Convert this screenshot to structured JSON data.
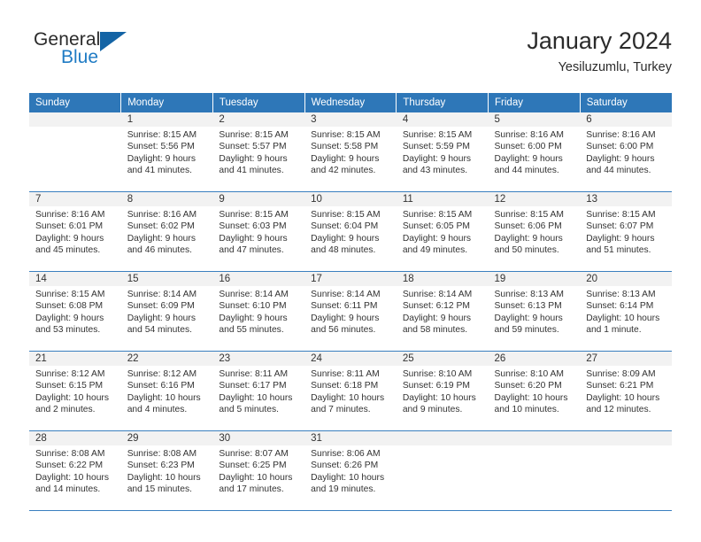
{
  "brand": {
    "name_part1": "General",
    "name_part2": "Blue",
    "logo_icon": "triangle-logo-icon",
    "accent_color": "#1f7bc4"
  },
  "header": {
    "title": "January 2024",
    "subtitle": "Yesiluzumlu, Turkey"
  },
  "calendar": {
    "header_bg": "#2e77b8",
    "daynum_bg": "#f2f2f2",
    "row_divider": "#3a7fbf",
    "weekday_headers": [
      "Sunday",
      "Monday",
      "Tuesday",
      "Wednesday",
      "Thursday",
      "Friday",
      "Saturday"
    ],
    "weeks": [
      [
        {
          "day": "",
          "sunrise": "",
          "sunset": "",
          "daylight_line1": "",
          "daylight_line2": "",
          "empty": true
        },
        {
          "day": "1",
          "sunrise": "Sunrise: 8:15 AM",
          "sunset": "Sunset: 5:56 PM",
          "daylight_line1": "Daylight: 9 hours",
          "daylight_line2": "and 41 minutes."
        },
        {
          "day": "2",
          "sunrise": "Sunrise: 8:15 AM",
          "sunset": "Sunset: 5:57 PM",
          "daylight_line1": "Daylight: 9 hours",
          "daylight_line2": "and 41 minutes."
        },
        {
          "day": "3",
          "sunrise": "Sunrise: 8:15 AM",
          "sunset": "Sunset: 5:58 PM",
          "daylight_line1": "Daylight: 9 hours",
          "daylight_line2": "and 42 minutes."
        },
        {
          "day": "4",
          "sunrise": "Sunrise: 8:15 AM",
          "sunset": "Sunset: 5:59 PM",
          "daylight_line1": "Daylight: 9 hours",
          "daylight_line2": "and 43 minutes."
        },
        {
          "day": "5",
          "sunrise": "Sunrise: 8:16 AM",
          "sunset": "Sunset: 6:00 PM",
          "daylight_line1": "Daylight: 9 hours",
          "daylight_line2": "and 44 minutes."
        },
        {
          "day": "6",
          "sunrise": "Sunrise: 8:16 AM",
          "sunset": "Sunset: 6:00 PM",
          "daylight_line1": "Daylight: 9 hours",
          "daylight_line2": "and 44 minutes."
        }
      ],
      [
        {
          "day": "7",
          "sunrise": "Sunrise: 8:16 AM",
          "sunset": "Sunset: 6:01 PM",
          "daylight_line1": "Daylight: 9 hours",
          "daylight_line2": "and 45 minutes."
        },
        {
          "day": "8",
          "sunrise": "Sunrise: 8:16 AM",
          "sunset": "Sunset: 6:02 PM",
          "daylight_line1": "Daylight: 9 hours",
          "daylight_line2": "and 46 minutes."
        },
        {
          "day": "9",
          "sunrise": "Sunrise: 8:15 AM",
          "sunset": "Sunset: 6:03 PM",
          "daylight_line1": "Daylight: 9 hours",
          "daylight_line2": "and 47 minutes."
        },
        {
          "day": "10",
          "sunrise": "Sunrise: 8:15 AM",
          "sunset": "Sunset: 6:04 PM",
          "daylight_line1": "Daylight: 9 hours",
          "daylight_line2": "and 48 minutes."
        },
        {
          "day": "11",
          "sunrise": "Sunrise: 8:15 AM",
          "sunset": "Sunset: 6:05 PM",
          "daylight_line1": "Daylight: 9 hours",
          "daylight_line2": "and 49 minutes."
        },
        {
          "day": "12",
          "sunrise": "Sunrise: 8:15 AM",
          "sunset": "Sunset: 6:06 PM",
          "daylight_line1": "Daylight: 9 hours",
          "daylight_line2": "and 50 minutes."
        },
        {
          "day": "13",
          "sunrise": "Sunrise: 8:15 AM",
          "sunset": "Sunset: 6:07 PM",
          "daylight_line1": "Daylight: 9 hours",
          "daylight_line2": "and 51 minutes."
        }
      ],
      [
        {
          "day": "14",
          "sunrise": "Sunrise: 8:15 AM",
          "sunset": "Sunset: 6:08 PM",
          "daylight_line1": "Daylight: 9 hours",
          "daylight_line2": "and 53 minutes."
        },
        {
          "day": "15",
          "sunrise": "Sunrise: 8:14 AM",
          "sunset": "Sunset: 6:09 PM",
          "daylight_line1": "Daylight: 9 hours",
          "daylight_line2": "and 54 minutes."
        },
        {
          "day": "16",
          "sunrise": "Sunrise: 8:14 AM",
          "sunset": "Sunset: 6:10 PM",
          "daylight_line1": "Daylight: 9 hours",
          "daylight_line2": "and 55 minutes."
        },
        {
          "day": "17",
          "sunrise": "Sunrise: 8:14 AM",
          "sunset": "Sunset: 6:11 PM",
          "daylight_line1": "Daylight: 9 hours",
          "daylight_line2": "and 56 minutes."
        },
        {
          "day": "18",
          "sunrise": "Sunrise: 8:14 AM",
          "sunset": "Sunset: 6:12 PM",
          "daylight_line1": "Daylight: 9 hours",
          "daylight_line2": "and 58 minutes."
        },
        {
          "day": "19",
          "sunrise": "Sunrise: 8:13 AM",
          "sunset": "Sunset: 6:13 PM",
          "daylight_line1": "Daylight: 9 hours",
          "daylight_line2": "and 59 minutes."
        },
        {
          "day": "20",
          "sunrise": "Sunrise: 8:13 AM",
          "sunset": "Sunset: 6:14 PM",
          "daylight_line1": "Daylight: 10 hours",
          "daylight_line2": "and 1 minute."
        }
      ],
      [
        {
          "day": "21",
          "sunrise": "Sunrise: 8:12 AM",
          "sunset": "Sunset: 6:15 PM",
          "daylight_line1": "Daylight: 10 hours",
          "daylight_line2": "and 2 minutes."
        },
        {
          "day": "22",
          "sunrise": "Sunrise: 8:12 AM",
          "sunset": "Sunset: 6:16 PM",
          "daylight_line1": "Daylight: 10 hours",
          "daylight_line2": "and 4 minutes."
        },
        {
          "day": "23",
          "sunrise": "Sunrise: 8:11 AM",
          "sunset": "Sunset: 6:17 PM",
          "daylight_line1": "Daylight: 10 hours",
          "daylight_line2": "and 5 minutes."
        },
        {
          "day": "24",
          "sunrise": "Sunrise: 8:11 AM",
          "sunset": "Sunset: 6:18 PM",
          "daylight_line1": "Daylight: 10 hours",
          "daylight_line2": "and 7 minutes."
        },
        {
          "day": "25",
          "sunrise": "Sunrise: 8:10 AM",
          "sunset": "Sunset: 6:19 PM",
          "daylight_line1": "Daylight: 10 hours",
          "daylight_line2": "and 9 minutes."
        },
        {
          "day": "26",
          "sunrise": "Sunrise: 8:10 AM",
          "sunset": "Sunset: 6:20 PM",
          "daylight_line1": "Daylight: 10 hours",
          "daylight_line2": "and 10 minutes."
        },
        {
          "day": "27",
          "sunrise": "Sunrise: 8:09 AM",
          "sunset": "Sunset: 6:21 PM",
          "daylight_line1": "Daylight: 10 hours",
          "daylight_line2": "and 12 minutes."
        }
      ],
      [
        {
          "day": "28",
          "sunrise": "Sunrise: 8:08 AM",
          "sunset": "Sunset: 6:22 PM",
          "daylight_line1": "Daylight: 10 hours",
          "daylight_line2": "and 14 minutes."
        },
        {
          "day": "29",
          "sunrise": "Sunrise: 8:08 AM",
          "sunset": "Sunset: 6:23 PM",
          "daylight_line1": "Daylight: 10 hours",
          "daylight_line2": "and 15 minutes."
        },
        {
          "day": "30",
          "sunrise": "Sunrise: 8:07 AM",
          "sunset": "Sunset: 6:25 PM",
          "daylight_line1": "Daylight: 10 hours",
          "daylight_line2": "and 17 minutes."
        },
        {
          "day": "31",
          "sunrise": "Sunrise: 8:06 AM",
          "sunset": "Sunset: 6:26 PM",
          "daylight_line1": "Daylight: 10 hours",
          "daylight_line2": "and 19 minutes."
        },
        {
          "day": "",
          "sunrise": "",
          "sunset": "",
          "daylight_line1": "",
          "daylight_line2": "",
          "empty": true
        },
        {
          "day": "",
          "sunrise": "",
          "sunset": "",
          "daylight_line1": "",
          "daylight_line2": "",
          "empty": true
        },
        {
          "day": "",
          "sunrise": "",
          "sunset": "",
          "daylight_line1": "",
          "daylight_line2": "",
          "empty": true
        }
      ]
    ]
  }
}
